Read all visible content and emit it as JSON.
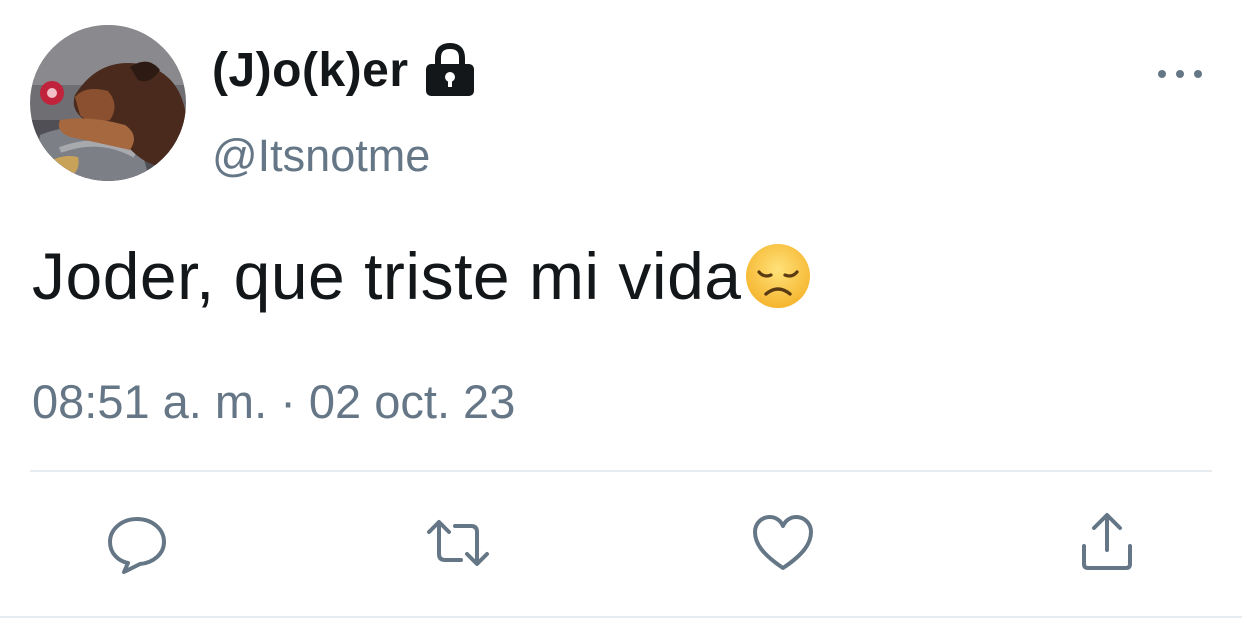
{
  "tweet": {
    "display_name": "(J)o(k)er",
    "handle": "@Itsnotme",
    "text": "Joder, que triste mi vida",
    "timestamp": "08:51 a. m. · 02 oct. 23",
    "emoji": "disappointed-face"
  },
  "icons": {
    "avatar": "dog-photo",
    "protected": "lock-icon",
    "more": "more-icon",
    "reply": "reply-icon",
    "retweet": "retweet-icon",
    "like": "heart-icon",
    "share": "share-icon"
  },
  "colors": {
    "text": "#14171a",
    "secondary": "#657786",
    "divider": "#e6ecf0",
    "background": "#ffffff"
  }
}
